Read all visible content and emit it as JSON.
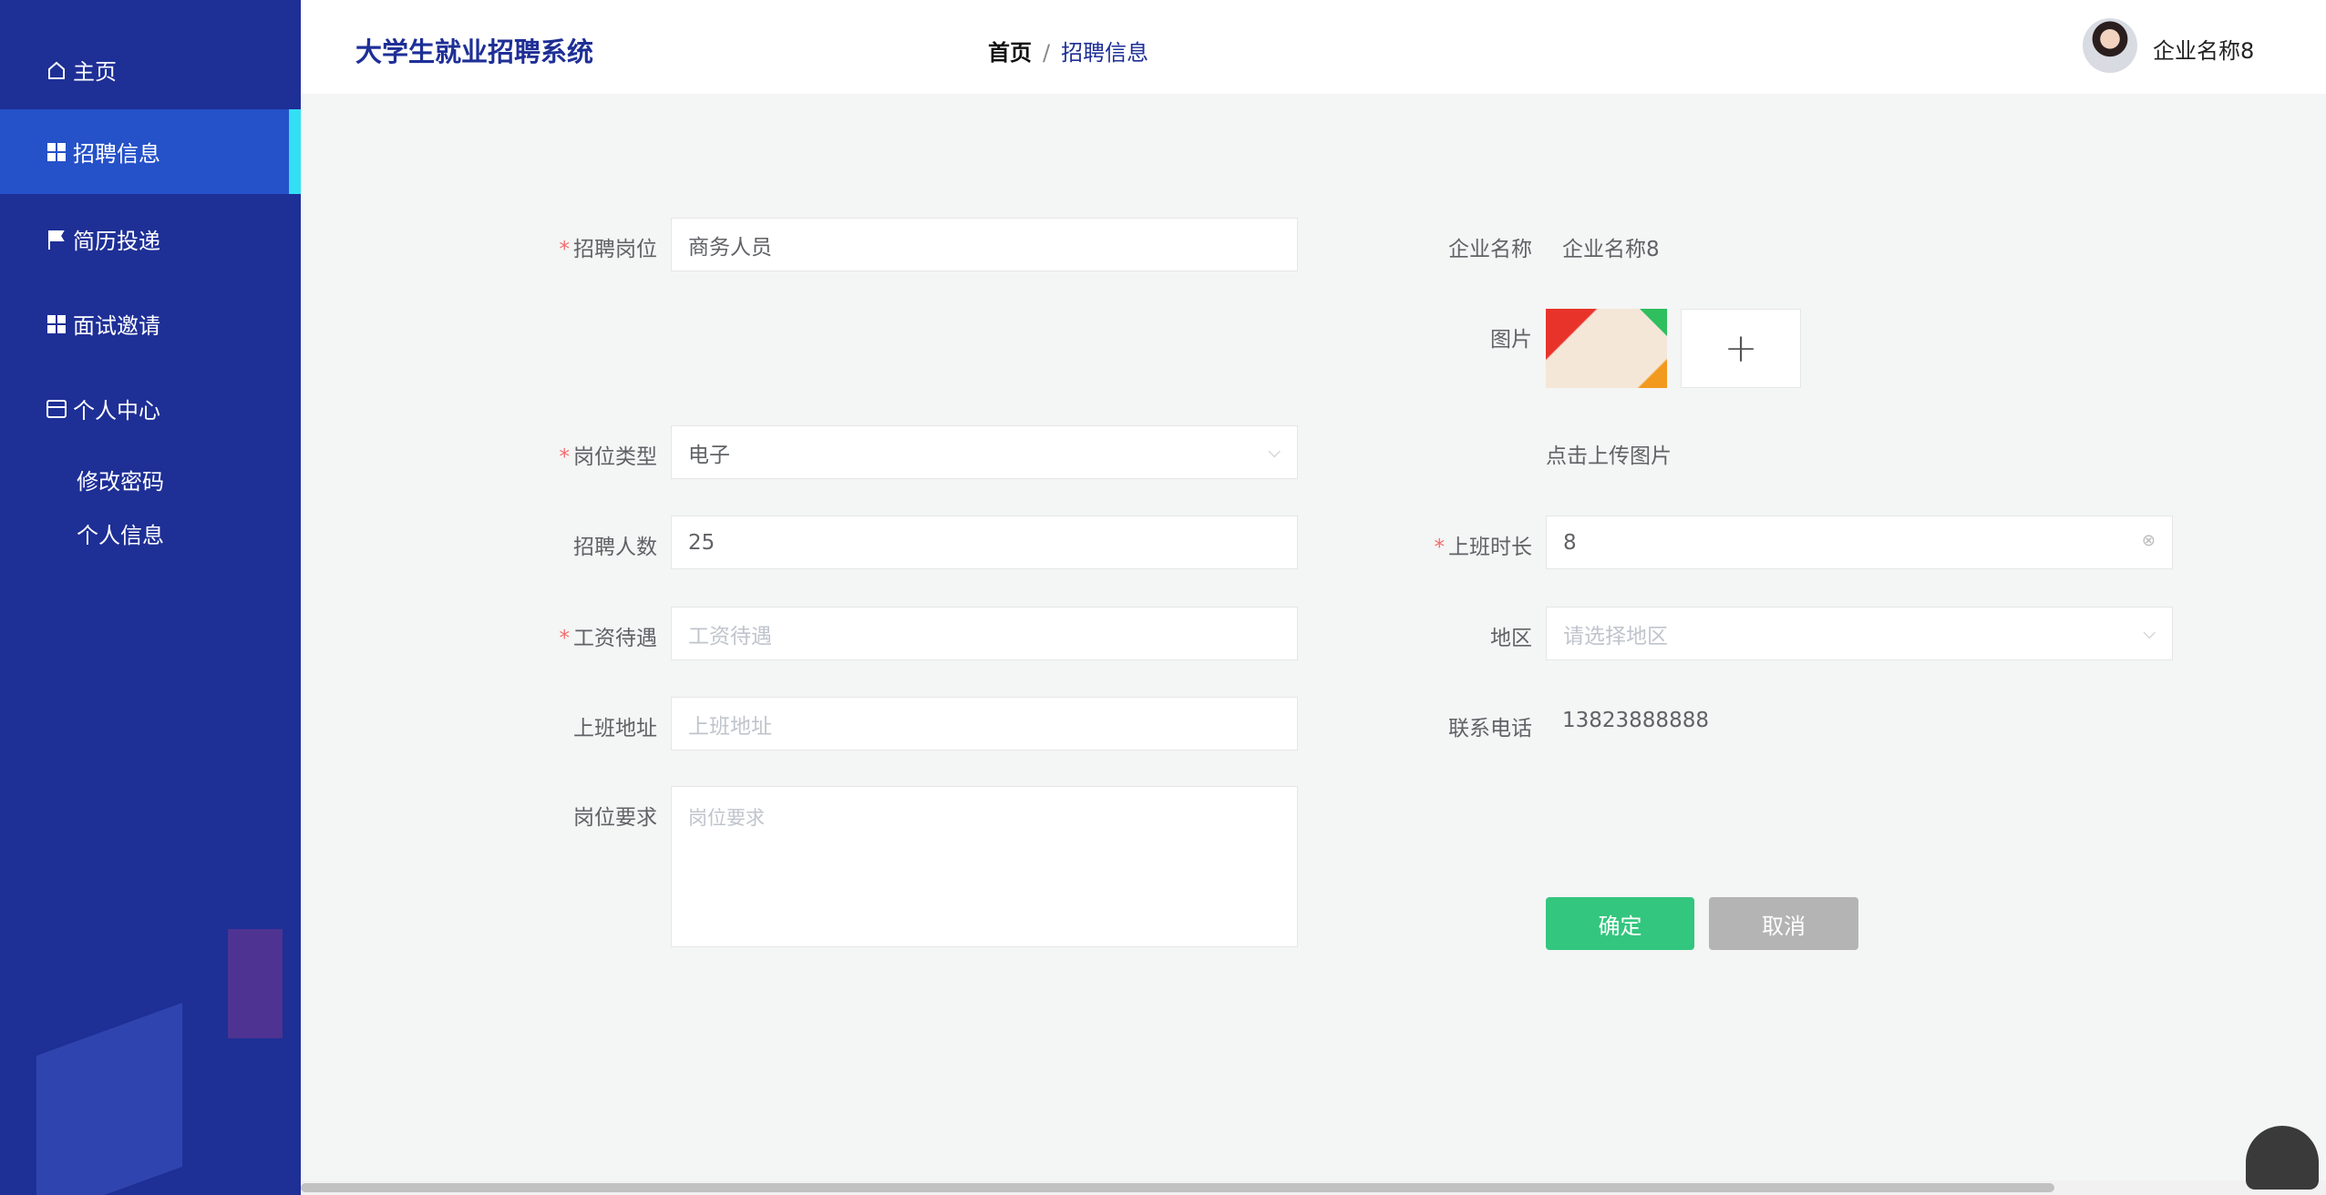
{
  "sidebar": {
    "items": [
      {
        "label": "主页",
        "icon": "home-icon"
      },
      {
        "label": "招聘信息",
        "icon": "grid-icon"
      },
      {
        "label": "简历投递",
        "icon": "flag-icon"
      },
      {
        "label": "面试邀请",
        "icon": "grid-icon"
      },
      {
        "label": "个人中心",
        "icon": "wallet-icon"
      }
    ],
    "sub_items": [
      "修改密码",
      "个人信息"
    ]
  },
  "header": {
    "title": "大学生就业招聘系统",
    "breadcrumb": {
      "home": "首页",
      "sep": "/",
      "current": "招聘信息"
    },
    "username": "企业名称8"
  },
  "form": {
    "position": {
      "label": "招聘岗位",
      "value": "商务人员"
    },
    "job_type": {
      "label": "岗位类型",
      "value": "电子"
    },
    "headcount": {
      "label": "招聘人数",
      "value": "25"
    },
    "salary": {
      "label": "工资待遇",
      "placeholder": "工资待遇"
    },
    "address": {
      "label": "上班地址",
      "placeholder": "上班地址"
    },
    "requirements": {
      "label": "岗位要求",
      "placeholder": "岗位要求"
    },
    "company": {
      "label": "企业名称",
      "value": "企业名称8"
    },
    "image": {
      "label": "图片",
      "hint": "点击上传图片"
    },
    "hours": {
      "label": "上班时长",
      "value": "8"
    },
    "region": {
      "label": "地区",
      "placeholder": "请选择地区"
    },
    "phone": {
      "label": "联系电话",
      "value": "13823888888"
    },
    "required_mark": "*",
    "confirm": "确定",
    "cancel": "取消"
  },
  "colors": {
    "sidebar": "#1e2f96",
    "active": "#2551c9",
    "confirm": "#33c67e",
    "cancel": "#b4b4b4"
  }
}
